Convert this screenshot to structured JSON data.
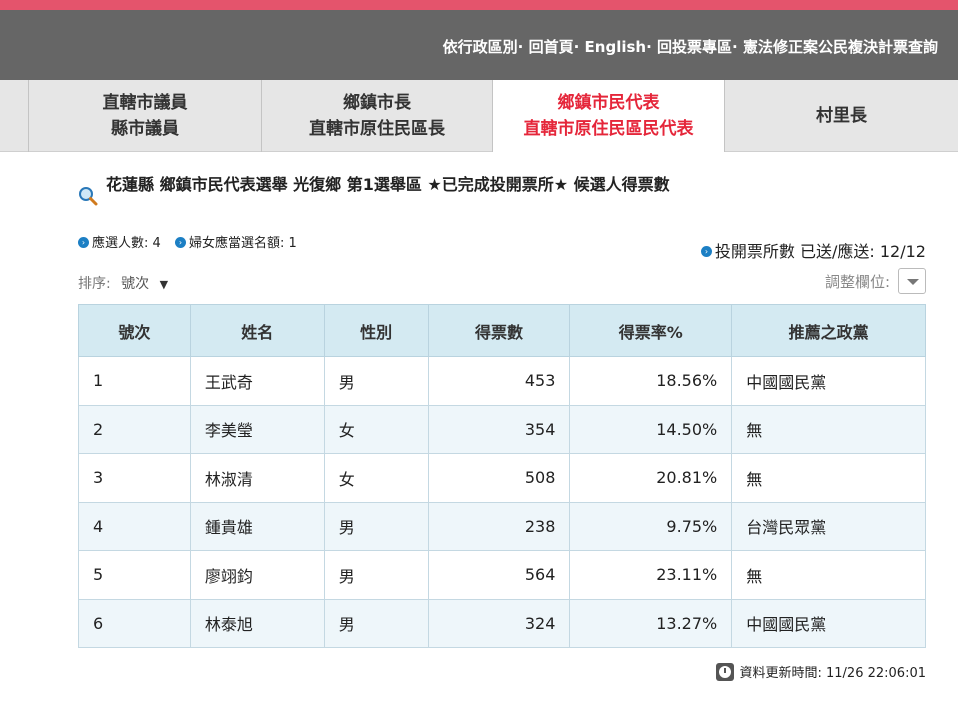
{
  "header": {
    "links": [
      {
        "label": "依行政區別"
      },
      {
        "label": "回首頁"
      },
      {
        "label": "English"
      },
      {
        "label": "回投票專區"
      },
      {
        "label": "憲法修正案公民複決計票查詢"
      }
    ],
    "separator": "·"
  },
  "tabs": [
    {
      "line1": "直轄市議員",
      "line2": "縣市議員"
    },
    {
      "line1": "鄉鎮市長",
      "line2": "直轄市原住民區長"
    },
    {
      "line1": "鄉鎮市民代表",
      "line2": "直轄市原住民區民代表"
    },
    {
      "line1": "村里長",
      "line2": ""
    }
  ],
  "title": "花蓮縣 鄉鎮市民代表選舉 光復鄉 第1選舉區 ★已完成投開票所★ 候選人得票數",
  "stats": {
    "elected_count": "應選人數: 4",
    "women_quota": "婦女應當選名額: 1",
    "stations": "投開票所數 已送/應送: 12/12"
  },
  "sort": {
    "label": "排序:",
    "value": "號次",
    "arrow": "▼"
  },
  "adjust_label": "調整欄位:",
  "table": {
    "headers": [
      "號次",
      "姓名",
      "性別",
      "得票數",
      "得票率%",
      "推薦之政黨"
    ],
    "rows": [
      {
        "no": "1",
        "name": "王武奇",
        "gender": "男",
        "votes": "453",
        "rate": "18.56%",
        "party": "中國國民黨"
      },
      {
        "no": "2",
        "name": "李美瑩",
        "gender": "女",
        "votes": "354",
        "rate": "14.50%",
        "party": "無"
      },
      {
        "no": "3",
        "name": "林淑清",
        "gender": "女",
        "votes": "508",
        "rate": "20.81%",
        "party": "無"
      },
      {
        "no": "4",
        "name": "鍾貴雄",
        "gender": "男",
        "votes": "238",
        "rate": "9.75%",
        "party": "台灣民眾黨"
      },
      {
        "no": "5",
        "name": "廖翊鈞",
        "gender": "男",
        "votes": "564",
        "rate": "23.11%",
        "party": "無"
      },
      {
        "no": "6",
        "name": "林泰旭",
        "gender": "男",
        "votes": "324",
        "rate": "13.27%",
        "party": "中國國民黨"
      }
    ]
  },
  "update_time": "資料更新時間: 11/26 22:06:01",
  "colors": {
    "accent_red": "#e5263a",
    "header_gray": "#666666",
    "table_header": "#d4eaf2"
  }
}
